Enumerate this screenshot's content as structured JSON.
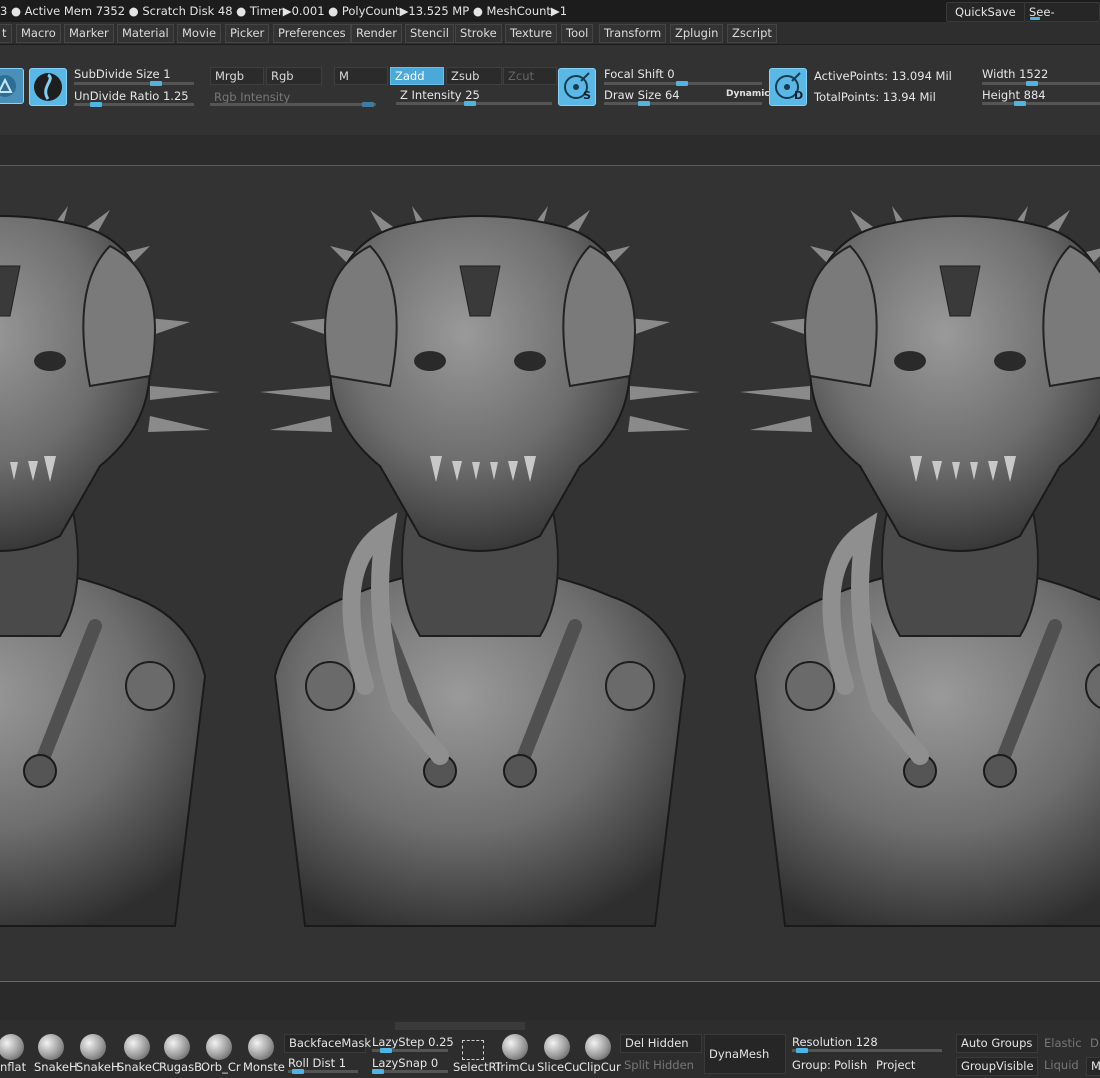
{
  "infobar": {
    "status": "3 ● Active Mem 7352 ● Scratch Disk 48 ●  Timer▶0.001 ● PolyCount▶13.525 MP  ● MeshCount▶1",
    "quicksave": "QuickSave",
    "see_through": "See-through"
  },
  "menu": [
    "t",
    "Macro",
    "Marker",
    "Material",
    "Movie",
    "Picker",
    "Preferences",
    "Render",
    "Stencil",
    "Stroke",
    "Texture",
    "Tool",
    "Transform",
    "Zplugin",
    "Zscript"
  ],
  "toolbar": {
    "subdivide_size": "SubDivide Size 1",
    "undivide_ratio": "UnDivide Ratio 1.25",
    "mrgb": "Mrgb",
    "rgb": "Rgb",
    "m": "M",
    "rgb_intensity": "Rgb Intensity",
    "zadd": "Zadd",
    "zsub": "Zsub",
    "zcut": "Zcut",
    "z_intensity": "Z Intensity 25",
    "focal_shift": "Focal Shift 0",
    "draw_size": "Draw Size 64",
    "dynamic": "Dynamic",
    "active_points": "ActivePoints: 13.094 Mil",
    "total_points": "TotalPoints: 13.94 Mil",
    "width": "Width 1522",
    "height": "Height 884",
    "s_letter": "S",
    "d_letter": "D"
  },
  "shelf": {
    "brushes": [
      "nflat",
      "SnakeH",
      "SnakeH",
      "SnakeC",
      "RugasB",
      "Orb_Cr",
      "Monste"
    ],
    "backface_mask": "BackfaceMask",
    "roll_dist": "Roll Dist 1",
    "lazy_step": "LazyStep 0.25",
    "lazy_snap": "LazySnap 0",
    "select_r": "SelectRi",
    "trim_cu": "TrimCu",
    "slice_cu": "SliceCu",
    "clip_cur": "ClipCur",
    "del_hidden": "Del Hidden",
    "split_hidden": "Split Hidden",
    "dynamesh": "DynaMesh",
    "resolution": "Resolution 128",
    "group": "Group:",
    "polish": "Polish",
    "project": "Project",
    "auto_groups": "Auto Groups",
    "elastic": "Elastic",
    "group_visible": "GroupVisible",
    "liquid": "Liquid",
    "d": "D",
    "m": "M"
  },
  "colors": {
    "accent": "#4fb5e0",
    "canvas": "#333333"
  }
}
